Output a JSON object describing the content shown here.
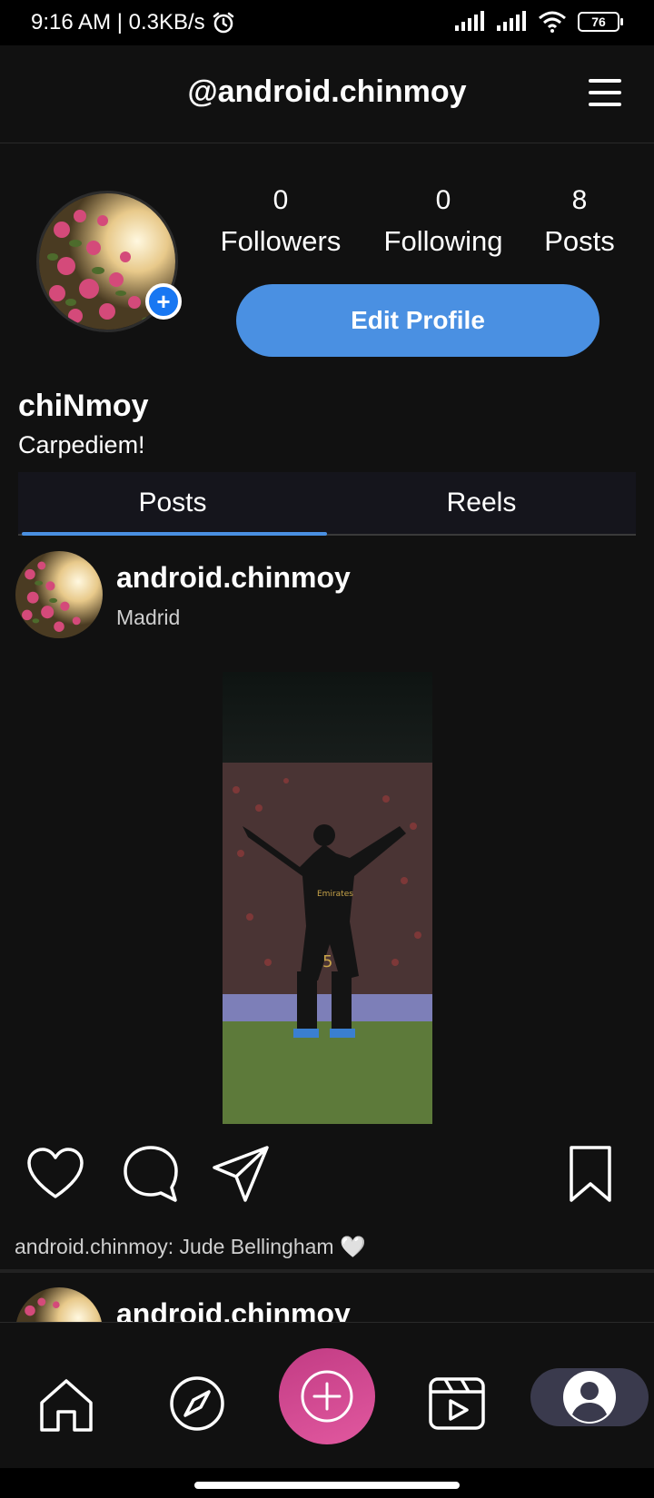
{
  "status_bar": {
    "left_text": "9:16 AM | 0.3KB/s",
    "battery": "76"
  },
  "header": {
    "title": "@android.chinmoy"
  },
  "profile": {
    "followers_count": "0",
    "followers_label": "Followers",
    "following_count": "0",
    "following_label": "Following",
    "posts_count": "8",
    "posts_label": "Posts",
    "edit_button": "Edit Profile",
    "add_symbol": "+",
    "display_name": "chiNmoy",
    "bio": "Carpediem!"
  },
  "tabs": [
    {
      "label": "Posts",
      "active": true
    },
    {
      "label": "Reels",
      "active": false
    }
  ],
  "posts": [
    {
      "username": "android.chinmoy",
      "location": "Madrid",
      "caption": "android.chinmoy: Jude Bellingham 🤍"
    },
    {
      "username": "android.chinmoy"
    }
  ],
  "colors": {
    "accent": "#4a90e2",
    "fab": "#d24b93",
    "background": "#111111"
  },
  "icons": {
    "status": [
      "alarm-icon",
      "signal-icon",
      "wifi-icon",
      "battery-icon"
    ],
    "header": "menu-icon",
    "actions": [
      "heart-icon",
      "comment-icon",
      "send-icon",
      "bookmark-icon"
    ],
    "nav": [
      "home-icon",
      "explore-icon",
      "add-icon",
      "reels-icon",
      "profile-icon"
    ]
  }
}
